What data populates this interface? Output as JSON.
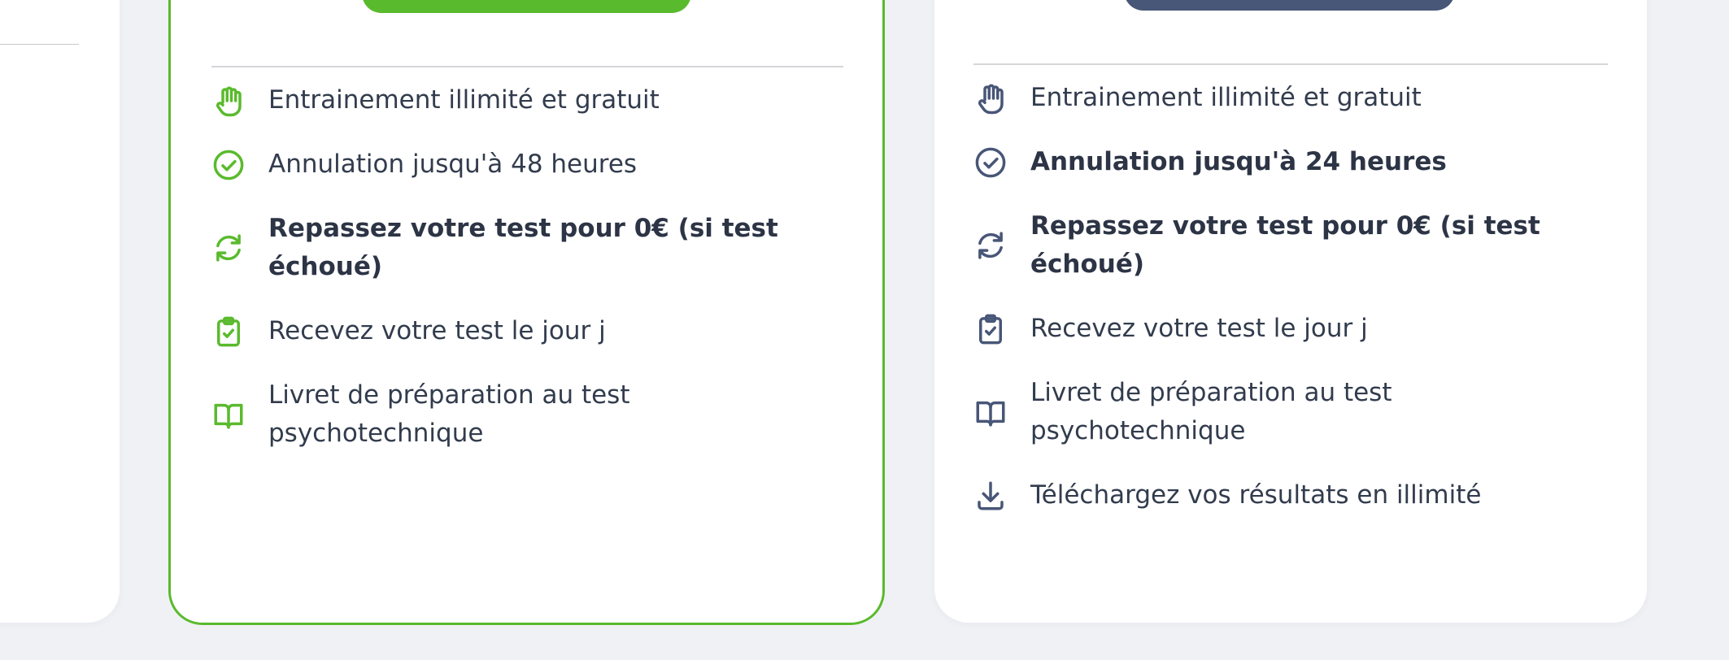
{
  "colors": {
    "page_background": "#f0f1f5",
    "card_background": "#ffffff",
    "green_accent": "#5aba2d",
    "navy_accent": "#485677",
    "text": "#323c4d"
  },
  "plans": [
    {
      "accent": "#5aba2d",
      "features": [
        {
          "icon": "hand-icon",
          "text": "Entrainement illimité et gratuit",
          "bold": false
        },
        {
          "icon": "check-circle-icon",
          "text": "Annulation jusqu'à 48 heures",
          "bold": false
        },
        {
          "icon": "refresh-icon",
          "text": "Repassez votre test pour 0€ (si test échoué)",
          "bold": true
        },
        {
          "icon": "clipboard-check-icon",
          "text": "Recevez votre test le jour j",
          "bold": false
        },
        {
          "icon": "book-icon",
          "text": "Livret de préparation au test psychotechnique",
          "bold": false
        }
      ]
    },
    {
      "accent": "#485677",
      "features": [
        {
          "icon": "hand-icon",
          "text": "Entrainement illimité et gratuit",
          "bold": false
        },
        {
          "icon": "check-circle-icon",
          "text": "Annulation jusqu'à 24 heures",
          "bold": true
        },
        {
          "icon": "refresh-icon",
          "text": "Repassez votre test pour 0€ (si test échoué)",
          "bold": true
        },
        {
          "icon": "clipboard-check-icon",
          "text": "Recevez votre test le jour j",
          "bold": false
        },
        {
          "icon": "book-icon",
          "text": "Livret de préparation au test psychotechnique",
          "bold": false
        },
        {
          "icon": "download-icon",
          "text": "Téléchargez vos résultats en illimité",
          "bold": false
        }
      ]
    }
  ]
}
